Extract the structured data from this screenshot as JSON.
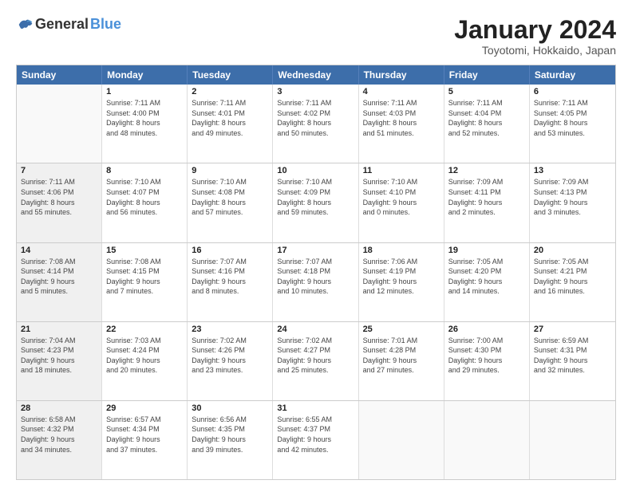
{
  "header": {
    "logo_general": "General",
    "logo_blue": "Blue",
    "month_title": "January 2024",
    "location": "Toyotomi, Hokkaido, Japan"
  },
  "calendar": {
    "weekdays": [
      "Sunday",
      "Monday",
      "Tuesday",
      "Wednesday",
      "Thursday",
      "Friday",
      "Saturday"
    ],
    "rows": [
      [
        {
          "day": "",
          "info": "",
          "empty": true
        },
        {
          "day": "1",
          "info": "Sunrise: 7:11 AM\nSunset: 4:00 PM\nDaylight: 8 hours\nand 48 minutes."
        },
        {
          "day": "2",
          "info": "Sunrise: 7:11 AM\nSunset: 4:01 PM\nDaylight: 8 hours\nand 49 minutes."
        },
        {
          "day": "3",
          "info": "Sunrise: 7:11 AM\nSunset: 4:02 PM\nDaylight: 8 hours\nand 50 minutes."
        },
        {
          "day": "4",
          "info": "Sunrise: 7:11 AM\nSunset: 4:03 PM\nDaylight: 8 hours\nand 51 minutes."
        },
        {
          "day": "5",
          "info": "Sunrise: 7:11 AM\nSunset: 4:04 PM\nDaylight: 8 hours\nand 52 minutes."
        },
        {
          "day": "6",
          "info": "Sunrise: 7:11 AM\nSunset: 4:05 PM\nDaylight: 8 hours\nand 53 minutes."
        }
      ],
      [
        {
          "day": "7",
          "info": "Sunrise: 7:11 AM\nSunset: 4:06 PM\nDaylight: 8 hours\nand 55 minutes.",
          "shaded": true
        },
        {
          "day": "8",
          "info": "Sunrise: 7:10 AM\nSunset: 4:07 PM\nDaylight: 8 hours\nand 56 minutes."
        },
        {
          "day": "9",
          "info": "Sunrise: 7:10 AM\nSunset: 4:08 PM\nDaylight: 8 hours\nand 57 minutes."
        },
        {
          "day": "10",
          "info": "Sunrise: 7:10 AM\nSunset: 4:09 PM\nDaylight: 8 hours\nand 59 minutes."
        },
        {
          "day": "11",
          "info": "Sunrise: 7:10 AM\nSunset: 4:10 PM\nDaylight: 9 hours\nand 0 minutes."
        },
        {
          "day": "12",
          "info": "Sunrise: 7:09 AM\nSunset: 4:11 PM\nDaylight: 9 hours\nand 2 minutes."
        },
        {
          "day": "13",
          "info": "Sunrise: 7:09 AM\nSunset: 4:13 PM\nDaylight: 9 hours\nand 3 minutes."
        }
      ],
      [
        {
          "day": "14",
          "info": "Sunrise: 7:08 AM\nSunset: 4:14 PM\nDaylight: 9 hours\nand 5 minutes.",
          "shaded": true
        },
        {
          "day": "15",
          "info": "Sunrise: 7:08 AM\nSunset: 4:15 PM\nDaylight: 9 hours\nand 7 minutes."
        },
        {
          "day": "16",
          "info": "Sunrise: 7:07 AM\nSunset: 4:16 PM\nDaylight: 9 hours\nand 8 minutes."
        },
        {
          "day": "17",
          "info": "Sunrise: 7:07 AM\nSunset: 4:18 PM\nDaylight: 9 hours\nand 10 minutes."
        },
        {
          "day": "18",
          "info": "Sunrise: 7:06 AM\nSunset: 4:19 PM\nDaylight: 9 hours\nand 12 minutes."
        },
        {
          "day": "19",
          "info": "Sunrise: 7:05 AM\nSunset: 4:20 PM\nDaylight: 9 hours\nand 14 minutes."
        },
        {
          "day": "20",
          "info": "Sunrise: 7:05 AM\nSunset: 4:21 PM\nDaylight: 9 hours\nand 16 minutes."
        }
      ],
      [
        {
          "day": "21",
          "info": "Sunrise: 7:04 AM\nSunset: 4:23 PM\nDaylight: 9 hours\nand 18 minutes.",
          "shaded": true
        },
        {
          "day": "22",
          "info": "Sunrise: 7:03 AM\nSunset: 4:24 PM\nDaylight: 9 hours\nand 20 minutes."
        },
        {
          "day": "23",
          "info": "Sunrise: 7:02 AM\nSunset: 4:26 PM\nDaylight: 9 hours\nand 23 minutes."
        },
        {
          "day": "24",
          "info": "Sunrise: 7:02 AM\nSunset: 4:27 PM\nDaylight: 9 hours\nand 25 minutes."
        },
        {
          "day": "25",
          "info": "Sunrise: 7:01 AM\nSunset: 4:28 PM\nDaylight: 9 hours\nand 27 minutes."
        },
        {
          "day": "26",
          "info": "Sunrise: 7:00 AM\nSunset: 4:30 PM\nDaylight: 9 hours\nand 29 minutes."
        },
        {
          "day": "27",
          "info": "Sunrise: 6:59 AM\nSunset: 4:31 PM\nDaylight: 9 hours\nand 32 minutes."
        }
      ],
      [
        {
          "day": "28",
          "info": "Sunrise: 6:58 AM\nSunset: 4:32 PM\nDaylight: 9 hours\nand 34 minutes.",
          "shaded": true
        },
        {
          "day": "29",
          "info": "Sunrise: 6:57 AM\nSunset: 4:34 PM\nDaylight: 9 hours\nand 37 minutes."
        },
        {
          "day": "30",
          "info": "Sunrise: 6:56 AM\nSunset: 4:35 PM\nDaylight: 9 hours\nand 39 minutes."
        },
        {
          "day": "31",
          "info": "Sunrise: 6:55 AM\nSunset: 4:37 PM\nDaylight: 9 hours\nand 42 minutes."
        },
        {
          "day": "",
          "info": "",
          "empty": true
        },
        {
          "day": "",
          "info": "",
          "empty": true
        },
        {
          "day": "",
          "info": "",
          "empty": true
        }
      ]
    ]
  }
}
